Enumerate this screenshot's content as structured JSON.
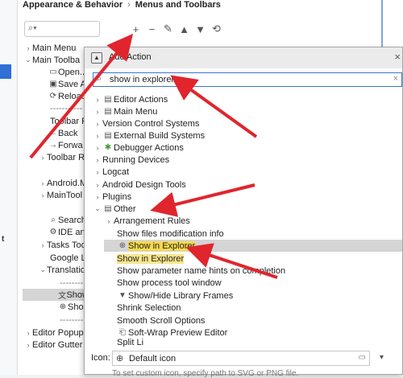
{
  "breadcrumb": {
    "parent": "Appearance & Behavior",
    "separator": "›",
    "current": "Menus and Toolbars"
  },
  "toolbar": {
    "add": "+",
    "remove": "−",
    "edit": "✎",
    "move_up": "▲",
    "move_down": "▼",
    "restore": "⟲"
  },
  "left_tree": [
    {
      "label": "Main Menu",
      "chevron": "›"
    },
    {
      "label": "Main Toolba",
      "chevron": "⌄"
    },
    {
      "label": "Open...",
      "icon": "▭"
    },
    {
      "label": "Save A",
      "icon": "▣"
    },
    {
      "label": "Reload",
      "icon": "⟳"
    },
    {
      "label": "-----------"
    },
    {
      "label": "Toolbar F"
    },
    {
      "label": "Back",
      "icon": "←"
    },
    {
      "label": "Forwa",
      "icon": "→"
    },
    {
      "label": "Toolbar R",
      "chevron": "›"
    },
    {
      "label": ""
    },
    {
      "label": "Android.M",
      "chevron": "›"
    },
    {
      "label": "MainTool",
      "chevron": "›"
    },
    {
      "label": ""
    },
    {
      "label": "Search",
      "icon": "⌕"
    },
    {
      "label": "IDE an",
      "icon": "⚙"
    },
    {
      "label": "Tasks Too",
      "chevron": "›"
    },
    {
      "label": "Google Lo"
    },
    {
      "label": "Translatio",
      "chevron": "⌄"
    },
    {
      "label": "--------"
    },
    {
      "label": "Show",
      "icon": "文"
    },
    {
      "label": "Sho",
      "icon": "⊕"
    },
    {
      "label": "--------"
    },
    {
      "label": "Editor Popup",
      "chevron": "›"
    },
    {
      "label": "Editor Gutter",
      "chevron": "›"
    }
  ],
  "dialog": {
    "title": "Add Action",
    "close": "×",
    "search": {
      "value": "show in explorer",
      "clear": "×"
    },
    "groups": [
      {
        "label": "Editor Actions",
        "chevron": "›",
        "icon": "▤"
      },
      {
        "label": "Main Menu",
        "chevron": "›",
        "icon": "▤"
      },
      {
        "label": "Version Control Systems",
        "chevron": "›",
        "icon": ""
      },
      {
        "label": "External Build Systems",
        "chevron": "›",
        "icon": "▤"
      },
      {
        "label": "Debugger Actions",
        "chevron": "›",
        "icon": "✱"
      },
      {
        "label": "Running Devices",
        "chevron": "›",
        "icon": ""
      },
      {
        "label": "Logcat",
        "chevron": "›",
        "icon": ""
      },
      {
        "label": "Android Design Tools",
        "chevron": "›",
        "icon": ""
      },
      {
        "label": "Plugins",
        "chevron": "›",
        "icon": ""
      },
      {
        "label": "Other",
        "chevron": "⌄",
        "icon": "▤"
      },
      {
        "label": "Arrangement Rules",
        "chevron": "›",
        "icon": ""
      },
      {
        "label": "Show files modification info",
        "chevron": "",
        "icon": ""
      },
      {
        "label_pre": "Show in Explorer",
        "chevron": "",
        "icon": "⊕"
      },
      {
        "label_pre": "Show in Explorer",
        "chevron": "",
        "icon": ""
      },
      {
        "label": "Show parameter name hints on completion",
        "chevron": "",
        "icon": ""
      },
      {
        "label": "Show process tool window",
        "chevron": "",
        "icon": ""
      },
      {
        "label": "Show/Hide Library Frames",
        "chevron": "",
        "icon": "▼"
      },
      {
        "label": "Shrink Selection",
        "chevron": "",
        "icon": ""
      },
      {
        "label": "Smooth Scroll Options",
        "chevron": "",
        "icon": ""
      },
      {
        "label": "Soft-Wrap Preview Editor",
        "chevron": "",
        "icon": "⎗"
      },
      {
        "label": "Split Li",
        "chevron": "",
        "icon": ""
      }
    ],
    "icon_field": {
      "label": "Icon:",
      "value": "Default icon",
      "folder": "▭",
      "dropdown": "▾"
    },
    "hint": "To set custom icon, specify path to SVG or PNG file."
  },
  "colors": {
    "arrow": "#e0252d",
    "selection": "#d5d5d5",
    "highlight": "#f5d94a",
    "accent": "#2f6fd6"
  },
  "icons": {
    "search": "search-icon",
    "dropdown_small": "chevron-down-icon"
  }
}
